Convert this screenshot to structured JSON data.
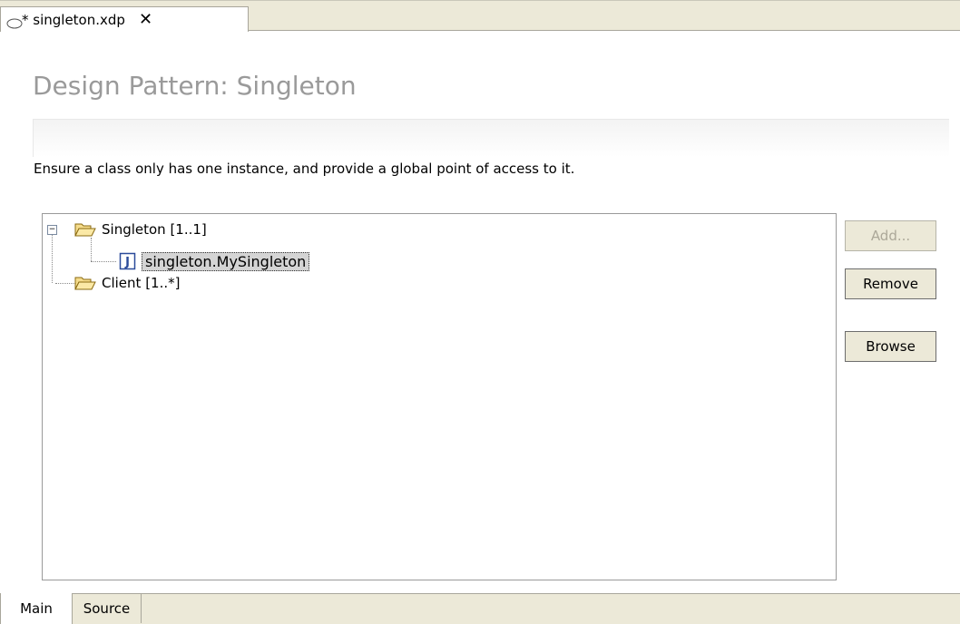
{
  "tab": {
    "title": "* singleton.xdp",
    "icon": "pattern-icon",
    "close": "✕"
  },
  "page": {
    "title": "Design Pattern: Singleton",
    "description": "Ensure a class only has one instance, and provide a global point of access to it."
  },
  "tree": {
    "nodes": [
      {
        "label": "Singleton [1..1]",
        "icon": "folder-open-icon",
        "expander": "−"
      },
      {
        "label": "singleton.MySingleton",
        "icon": "java-class-icon",
        "selected": true
      },
      {
        "label": "Client [1..*]",
        "icon": "folder-open-icon"
      }
    ]
  },
  "buttons": {
    "add": "Add...",
    "remove": "Remove",
    "browse": "Browse"
  },
  "page_tabs": {
    "main": "Main",
    "source": "Source"
  }
}
